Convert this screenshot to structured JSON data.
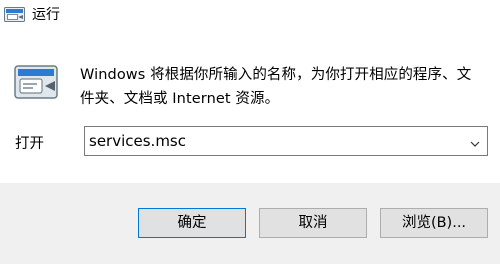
{
  "window": {
    "title": "运行"
  },
  "description": "Windows 将根据你所输入的名称，为你打开相应的程序、文件夹、文档或 Internet 资源。",
  "open": {
    "label": "打开",
    "value": "services.msc"
  },
  "buttons": {
    "ok": "确定",
    "cancel": "取消",
    "browse": "浏览(B)..."
  },
  "icons": {
    "app": "run-app-icon",
    "content": "run-app-icon",
    "dropdown": "chevron-down-icon"
  },
  "colors": {
    "accent": "#0078d7",
    "footer_bg": "#f0f0f0",
    "button_bg": "#e1e1e1"
  }
}
